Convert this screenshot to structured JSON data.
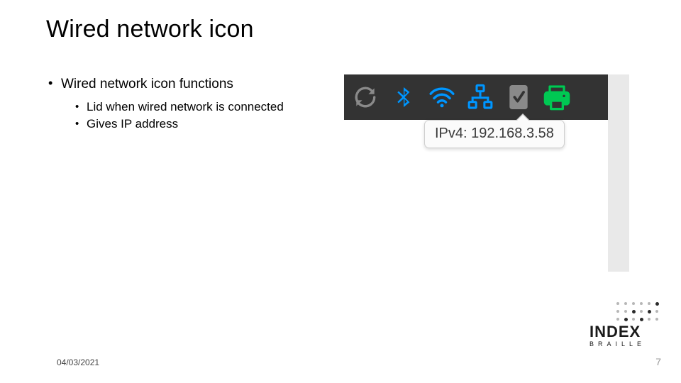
{
  "title": "Wired network icon",
  "bullets": {
    "l1": "Wired network icon functions",
    "l2a": "Lid when wired network is connected",
    "l2b": "Gives IP address"
  },
  "tray": {
    "icons": {
      "refresh": "refresh-icon",
      "bluetooth": "bluetooth-icon",
      "wifi": "wifi-icon",
      "ethernet": "ethernet-icon",
      "check": "checkmark-icon",
      "printer": "printer-icon"
    },
    "tooltip": "IPv4: 192.168.3.58"
  },
  "footer": {
    "date": "04/03/2021",
    "page": "7"
  },
  "logo": {
    "word": "INDEX",
    "sub": "BRAILLE"
  },
  "colors": {
    "trayBg": "#333333",
    "iconMuted": "#8a8a8a",
    "iconBlue": "#0096ff",
    "iconGreen": "#00c853"
  }
}
